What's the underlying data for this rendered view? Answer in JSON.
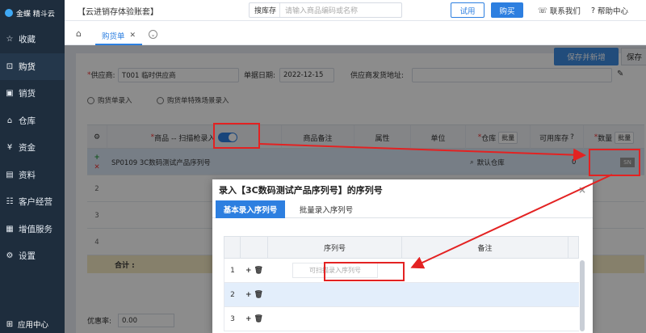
{
  "sidebar": {
    "logo": "金蝶 精斗云",
    "items": [
      {
        "label": "收藏",
        "icon": "☆",
        "active": false
      },
      {
        "label": "购货",
        "icon": "⊡",
        "active": true
      },
      {
        "label": "销货",
        "icon": "▣",
        "active": false
      },
      {
        "label": "仓库",
        "icon": "⌂",
        "active": false
      },
      {
        "label": "资金",
        "icon": "¥",
        "active": false
      },
      {
        "label": "资料",
        "icon": "▤",
        "active": false
      },
      {
        "label": "客户经营",
        "icon": "☷",
        "active": false
      },
      {
        "label": "增值服务",
        "icon": "▦",
        "active": false
      },
      {
        "label": "设置",
        "icon": "⚙",
        "active": false
      }
    ],
    "bottom": "应用中心"
  },
  "topbar": {
    "account": "【云进销存体验账套】",
    "search_label": "搜库存",
    "search_placeholder": "请输入商品编码或名称",
    "trial": "试用",
    "buy": "购买",
    "contact": "联系我们",
    "help": "帮助中心"
  },
  "tabs": {
    "active": "购货单"
  },
  "form": {
    "save_new": "保存并新增",
    "save": "保存",
    "supplier_label": "供应商:",
    "supplier_value": "T001 临时供应商",
    "date_label": "单据日期:",
    "date_value": "2022-12-15",
    "address_label": "供应商发货地址:",
    "link1": "购货单录入",
    "link2": "购货单特殊场景录入"
  },
  "table": {
    "headers": {
      "product": "商品 -- 扫描枪录入",
      "note": "商品备注",
      "attr": "属性",
      "unit": "单位",
      "warehouse": "仓库",
      "batch": "批量",
      "stock": "可用库存",
      "qty": "数量",
      "qty_batch": "批量"
    },
    "row1": {
      "product": "SP0109 3C数码测试产品序列号",
      "warehouse": "默认仓库",
      "stock": "0",
      "sn": "SN"
    },
    "rows": [
      "2",
      "3",
      "4"
    ],
    "total": "合计 :",
    "discount_label": "优惠率:",
    "discount_value": "0.00"
  },
  "modal": {
    "title": "录入【3C数码测试产品序列号】的序列号",
    "tab_basic": "基本录入序列号",
    "tab_batch": "批量录入序列号",
    "col_sn": "序列号",
    "col_note": "备注",
    "placeholder": "可扫描录入序列号",
    "rows": [
      "1",
      "2",
      "3"
    ]
  }
}
